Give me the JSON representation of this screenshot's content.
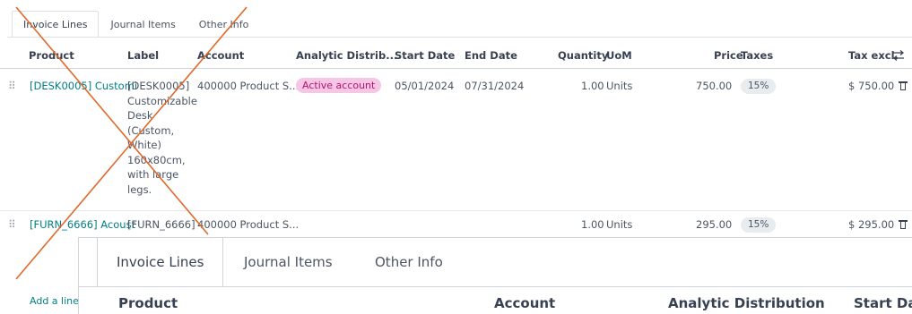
{
  "tabs": [
    "Invoice Lines",
    "Journal Items",
    "Other Info"
  ],
  "columns": {
    "product": "Product",
    "label": "Label",
    "account": "Account",
    "analytic": "Analytic Distrib...",
    "start_date": "Start Date",
    "end_date": "End Date",
    "quantity": "Quantity",
    "uom": "UoM",
    "price": "Price",
    "taxes": "Taxes",
    "tax_excl": "Tax excl."
  },
  "rows": [
    {
      "product": "[DESK0005] Customi",
      "label": "[DESK0005] Customizable Desk (Custom, White) 160x80cm, with large legs.",
      "account": "400000 Product S...",
      "analytic": "Active account",
      "start_date": "05/01/2024",
      "end_date": "07/31/2024",
      "quantity": "1.00",
      "uom": "Units",
      "price": "750.00",
      "tax": "15%",
      "subtotal": "$ 750.00"
    },
    {
      "product": "[FURN_6666] Acoust",
      "label": "[FURN_6666]",
      "account": "400000 Product S...",
      "quantity": "1.00",
      "uom": "Units",
      "price": "295.00",
      "tax": "15%",
      "subtotal": "$ 295.00"
    }
  ],
  "add_line": "Add a line",
  "zoom": {
    "tabs": [
      "Invoice Lines",
      "Journal Items",
      "Other Info"
    ],
    "columns": [
      "Product",
      "Account",
      "Analytic Distribution",
      "Start Da"
    ]
  },
  "colors": {
    "link": "#017e84",
    "active_account_bg": "#f6c6e6",
    "active_account_fg": "#b3126e",
    "cross": "#e0692a"
  },
  "icons": [
    "drag-handle-icon",
    "trash-icon",
    "column-settings-icon"
  ]
}
